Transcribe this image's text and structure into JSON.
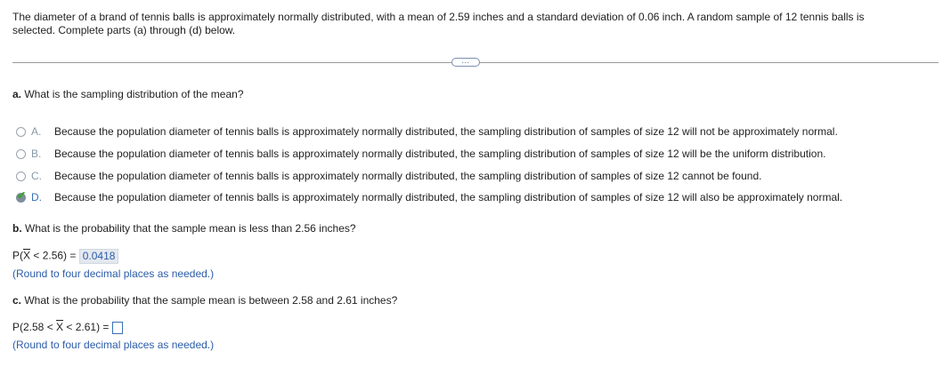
{
  "intro": {
    "line1": "The diameter of a brand of tennis balls is approximately normally distributed, with a mean of 2.59 inches and a standard deviation of 0.06 inch. A random sample of 12 tennis balls is",
    "line2": "selected. Complete parts (a) through (d) below."
  },
  "expand_label": "...",
  "part_a": {
    "label": "a.",
    "question": "What is the sampling distribution of the mean?",
    "options": [
      {
        "letter": "A.",
        "text": "Because the population diameter of tennis balls is approximately normally distributed, the sampling distribution of samples of size 12 will not be approximately normal.",
        "selected": false
      },
      {
        "letter": "B.",
        "text": "Because the population diameter of tennis balls is approximately normally distributed, the sampling distribution of samples of size 12 will be the uniform distribution.",
        "selected": false
      },
      {
        "letter": "C.",
        "text": "Because the population diameter of tennis balls is approximately normally distributed, the sampling distribution of samples of size 12 cannot be found.",
        "selected": false
      },
      {
        "letter": "D.",
        "text": "Because the population diameter of tennis balls is approximately normally distributed, the sampling distribution of samples of size 12 will also be approximately normal.",
        "selected": true
      }
    ]
  },
  "part_b": {
    "label": "b.",
    "question": "What is the probability that the sample mean is less than 2.56 inches?",
    "expr_prefix": "P(",
    "expr_var": "X",
    "expr_suffix": " < 2.56) = ",
    "answer": "0.0418",
    "note": "(Round to four decimal places as needed.)"
  },
  "part_c": {
    "label": "c.",
    "question": "What is the probability that the sample mean is between 2.58 and 2.61 inches?",
    "expr_prefix": "P(2.58 < ",
    "expr_var": "X",
    "expr_suffix": " < 2.61) = ",
    "answer": "",
    "note": "(Round to four decimal places as needed.)"
  },
  "colors": {
    "link_blue": "#2c5caa",
    "check_green": "#3aa32f",
    "answer_bg": "#e4e8ef"
  }
}
